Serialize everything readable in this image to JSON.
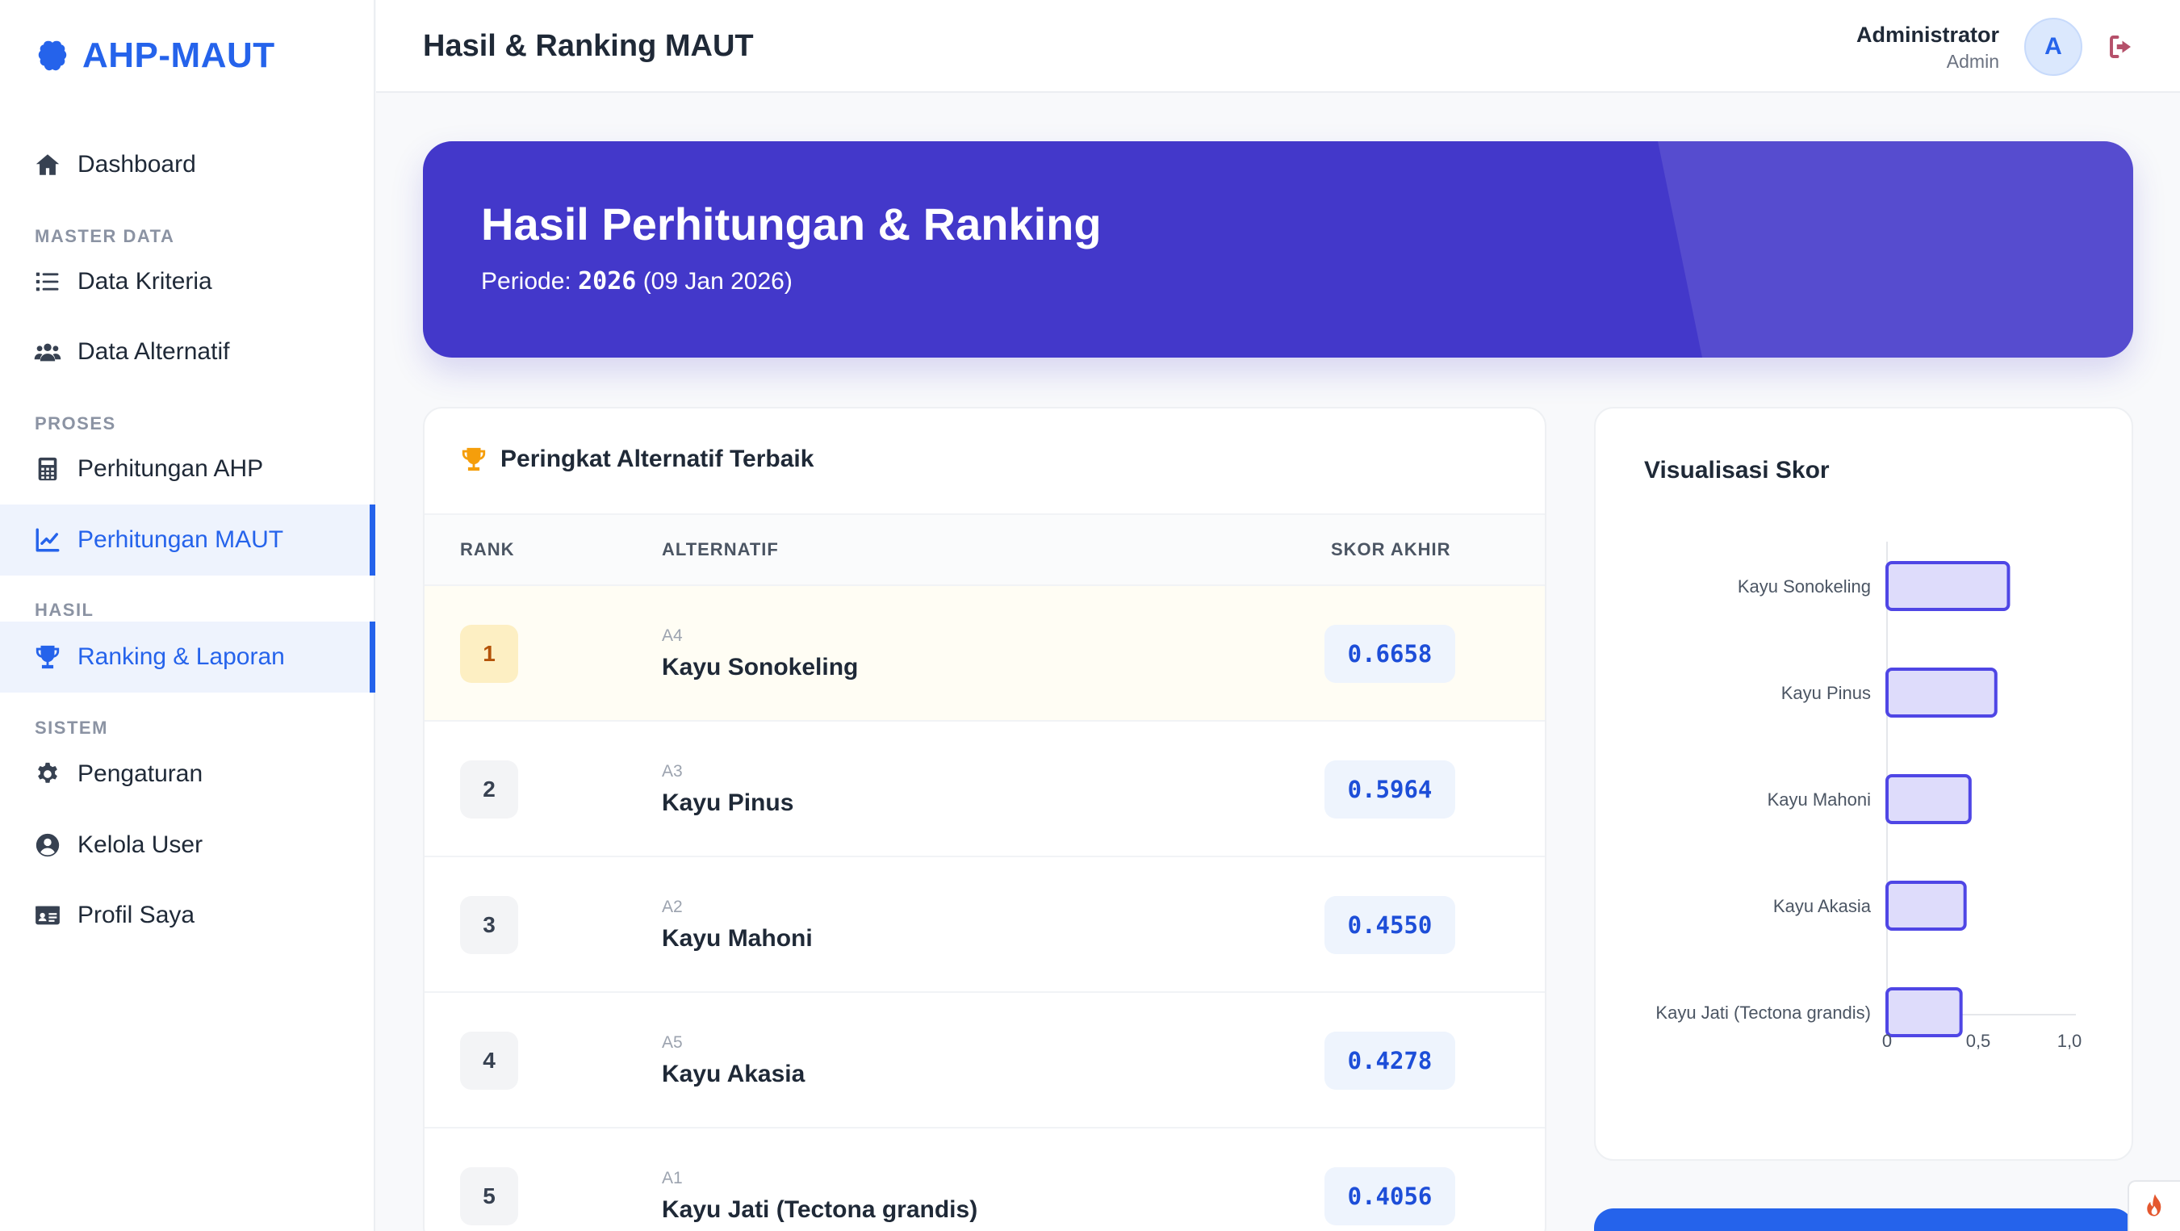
{
  "brand": {
    "name": "AHP-MAUT"
  },
  "sidebar": {
    "dashboard": "Dashboard",
    "sections": {
      "master": "MASTER DATA",
      "proses": "PROSES",
      "hasil": "HASIL",
      "sistem": "SISTEM"
    },
    "items": {
      "kriteria": "Data Kriteria",
      "alternatif": "Data Alternatif",
      "ahp": "Perhitungan AHP",
      "maut": "Perhitungan MAUT",
      "ranking": "Ranking & Laporan",
      "pengaturan": "Pengaturan",
      "kelola_user": "Kelola User",
      "profil": "Profil Saya"
    }
  },
  "header": {
    "title": "Hasil & Ranking MAUT",
    "user_name": "Administrator",
    "user_role": "Admin",
    "avatar_initial": "A"
  },
  "hero": {
    "title": "Hasil Perhitungan & Ranking",
    "period_label": "Periode:",
    "period_year": "2026",
    "period_date": "(09 Jan 2026)"
  },
  "ranking": {
    "title": "Peringkat Alternatif Terbaik",
    "columns": {
      "rank": "RANK",
      "alternatif": "ALTERNATIF",
      "skor": "SKOR AKHIR"
    },
    "rows": [
      {
        "rank": "1",
        "code": "A4",
        "name": "Kayu Sonokeling",
        "score": "0.6658"
      },
      {
        "rank": "2",
        "code": "A3",
        "name": "Kayu Pinus",
        "score": "0.5964"
      },
      {
        "rank": "3",
        "code": "A2",
        "name": "Kayu Mahoni",
        "score": "0.4550"
      },
      {
        "rank": "4",
        "code": "A5",
        "name": "Kayu Akasia",
        "score": "0.4278"
      },
      {
        "rank": "5",
        "code": "A1",
        "name": "Kayu Jati (Tectona grandis)",
        "score": "0.4056"
      }
    ]
  },
  "chart_data": {
    "type": "bar",
    "orientation": "horizontal",
    "title": "Visualisasi Skor",
    "categories": [
      "Kayu Sonokeling",
      "Kayu Pinus",
      "Kayu Mahoni",
      "Kayu Akasia",
      "Kayu Jati (Tectona grandis)"
    ],
    "values": [
      0.6658,
      0.5964,
      0.455,
      0.4278,
      0.4056
    ],
    "xlim": [
      0,
      1.0
    ],
    "x_ticks": [
      "0",
      "0,5",
      "1,0"
    ],
    "grid": false,
    "legend": "none",
    "bar_fill": "#dedcfb",
    "bar_stroke": "#4f46e5"
  },
  "colors": {
    "accent": "#2563eb",
    "hero": "#4338ca",
    "gold": "#f59e0b"
  }
}
